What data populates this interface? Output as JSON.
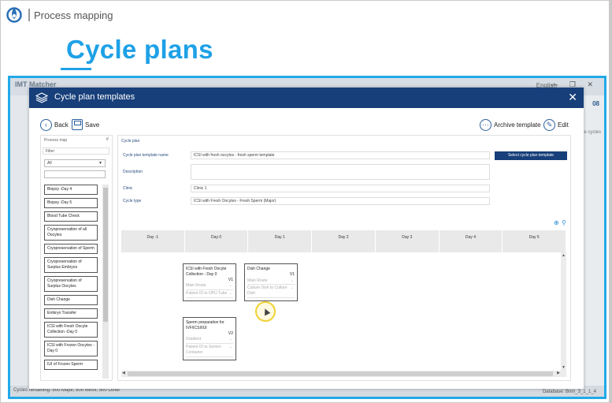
{
  "header": {
    "breadcrumb": "Process mapping",
    "title": "Cycle plans"
  },
  "colors": {
    "accent": "#1ea1e6",
    "modal_header": "#173f7a",
    "frame": "#22a9e9"
  },
  "background_app": {
    "app_name": "IMT Matcher",
    "language": "English",
    "right_label": "08",
    "right_sub": "ue cycles",
    "status_left": "Cycles remaining: 500 Major, 500 Minor, 500 Other",
    "status_right": "Database: Bnm_3_1_1_4"
  },
  "modal": {
    "title": "Cycle plan templates",
    "toolbar": {
      "back": "Back",
      "save": "Save",
      "archive": "Archive template",
      "edit": "Edit"
    },
    "process_map": {
      "header": "Process map",
      "pin": "#",
      "filter_label": "Filter",
      "filter_value": "All",
      "items": [
        "Biopsy -Day 4",
        "Biopsy -Day 5",
        "Blood Tube Check",
        "Cryopreservation of all Oocytes",
        "Cryopreservation of Sperm",
        "Cryopreservation of Surplus Embryos",
        "Cryopreservation of Surplus Oocytes",
        "Dish Change",
        "Embryo Transfer",
        "ICSI with Fresh Oocyte Collection -Day 0",
        "ICSI with Frozen Oocytes -Day 0",
        "IUI of Frozen Sperm"
      ]
    },
    "cycle_plan": {
      "section_title": "Cycle plan",
      "template_name_label": "Cycle plan template name",
      "template_name_value": "ICSI with fresh oocytes - fresh sperm template",
      "select_button": "Select cycle plan template",
      "description_label": "Description",
      "description_value": "",
      "clinic_label": "Clinic",
      "clinic_value": "Clinic 1",
      "cycle_type_label": "Cycle type",
      "cycle_type_value": "ICSI with Fresh Oocytes - Fresh Sperm (Major)",
      "days": [
        "Day -1",
        "Day 0",
        "Day 1",
        "Day 2",
        "Day 3",
        "Day 4",
        "Day 5"
      ],
      "cards": {
        "icsi": {
          "title": "ICSI with Fresh Oocyte Collection - Day 0",
          "version": "V1",
          "f1": "Main Route",
          "f2": "Patient ID to OPU Tube"
        },
        "dish": {
          "title": "Dish Change",
          "version": "V1",
          "f1": "Main Route",
          "f2": "Culture Dish to Culture Dish"
        },
        "sperm": {
          "title": "Sperm preparation for IVF/ICSI/IUI",
          "version": "V2",
          "f1": "Gradient",
          "f2": "Patient ID to Semen Container"
        }
      }
    }
  }
}
